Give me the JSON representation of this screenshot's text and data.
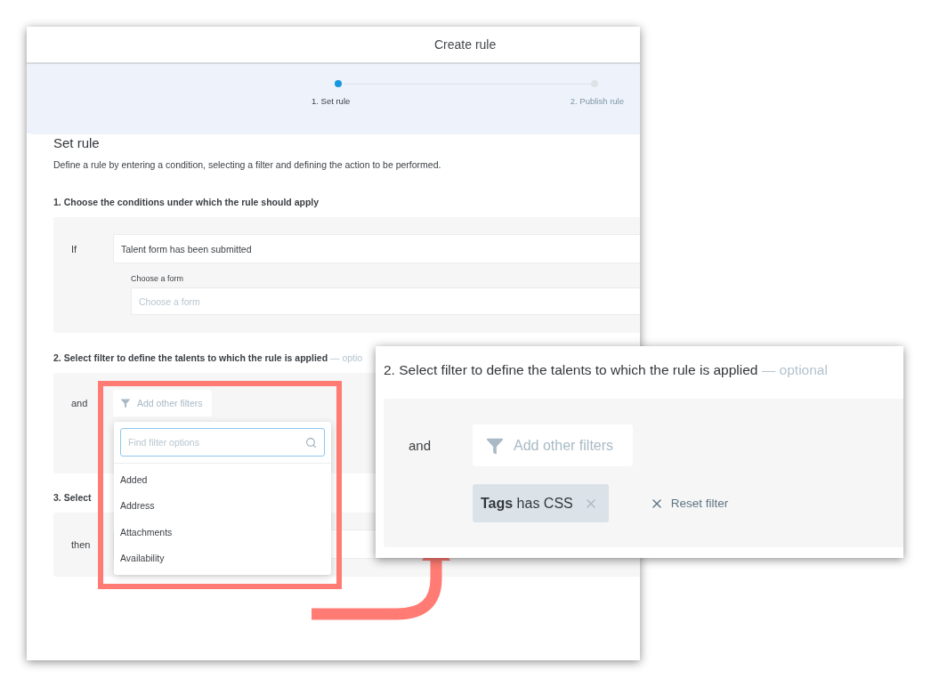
{
  "window": {
    "title": "Create rule"
  },
  "stepper": [
    {
      "label": "1. Set rule",
      "selected": true
    },
    {
      "label": "2. Publish rule",
      "selected": false
    }
  ],
  "section": {
    "title": "Set rule",
    "description": "Define a rule by entering a condition, selecting a filter and defining the action to be performed."
  },
  "steps": [
    {
      "kind": "condition",
      "heading": "1. Choose the conditions under which the rule should apply",
      "keyword": "If",
      "value": "Talent form has been submitted",
      "form_label": "Choose a form",
      "form_placeholder": "Choose a form"
    },
    {
      "kind": "filter",
      "heading": "2. Select filter to define the talents to which the rule is applied",
      "optional": "— optio",
      "keyword": "and",
      "button": "Add other filters"
    },
    {
      "kind": "action",
      "heading": "3. Select",
      "keyword": "then"
    }
  ],
  "dropdown": {
    "placeholder": "Find filter options",
    "options": [
      "Added",
      "Address",
      "Attachments",
      "Availability"
    ]
  },
  "callout": {
    "heading": "2. Select filter to define the talents to which the rule is applied",
    "optional": "— optional",
    "keyword": "and",
    "button": "Add other filters",
    "chip": "**Tags** has CSS",
    "reset": "Reset filter"
  }
}
